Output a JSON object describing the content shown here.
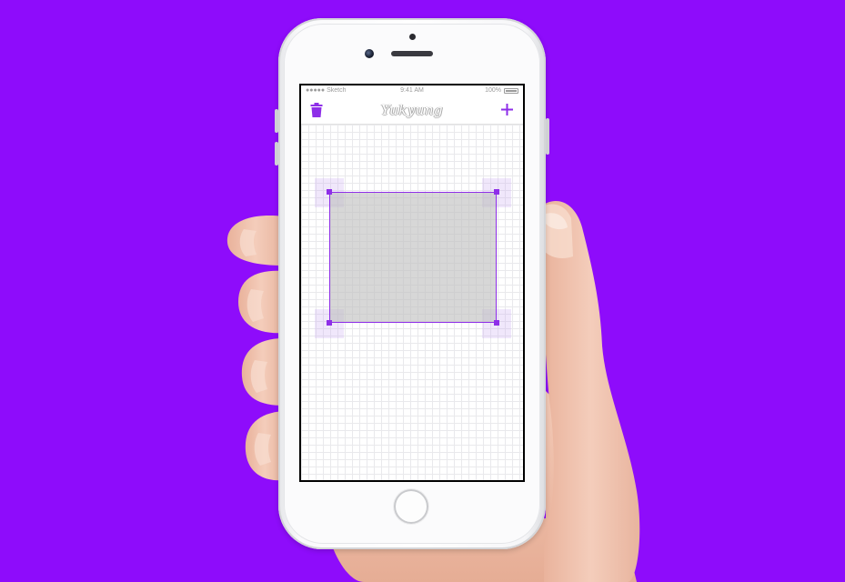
{
  "status_bar": {
    "carrier": "●●●●● Sketch",
    "time": "9:41 AM",
    "battery": "100%"
  },
  "nav_bar": {
    "title": "Yukyung",
    "left_icon": "trash-icon",
    "right_icon": "plus-icon"
  },
  "canvas": {
    "grid": true,
    "selected_shape": "rectangle",
    "shape_fill": "#bebebe",
    "handle_count": 4
  },
  "colors": {
    "background": "#8e0cfb",
    "accent": "#8e2ee8"
  }
}
